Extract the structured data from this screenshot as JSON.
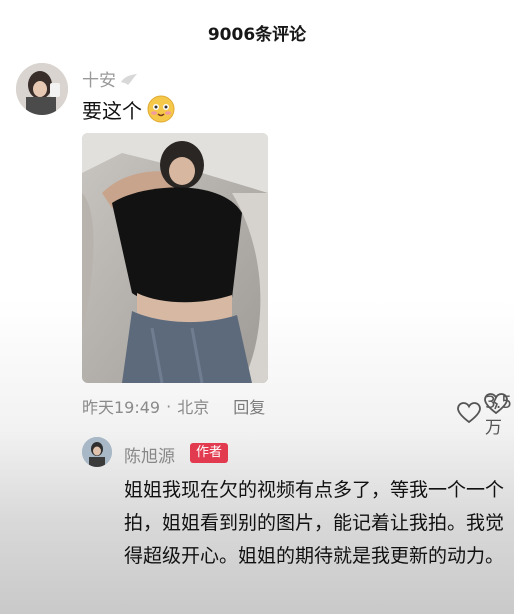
{
  "header": {
    "title": "9006条评论"
  },
  "comment": {
    "username": "十安",
    "text": "要这个",
    "time": "昨天19:49",
    "separator": "·",
    "location": "北京",
    "reply_label": "回复",
    "like_count": "3.5万"
  },
  "reply": {
    "username": "陈旭源",
    "badge": "作者",
    "text": "姐姐我现在欠的视频有点多了，等我一个一个拍，姐姐看到别的图片，能记着让我拍。我觉得超级开心。姐姐的期待就是我更新的动力。"
  },
  "colors": {
    "badge_bg": "#e23a4e",
    "meta_text": "#8a8a8a"
  },
  "icons": [
    "dove-icon",
    "emoji-icon",
    "heart-icon",
    "broken-heart-icon"
  ]
}
